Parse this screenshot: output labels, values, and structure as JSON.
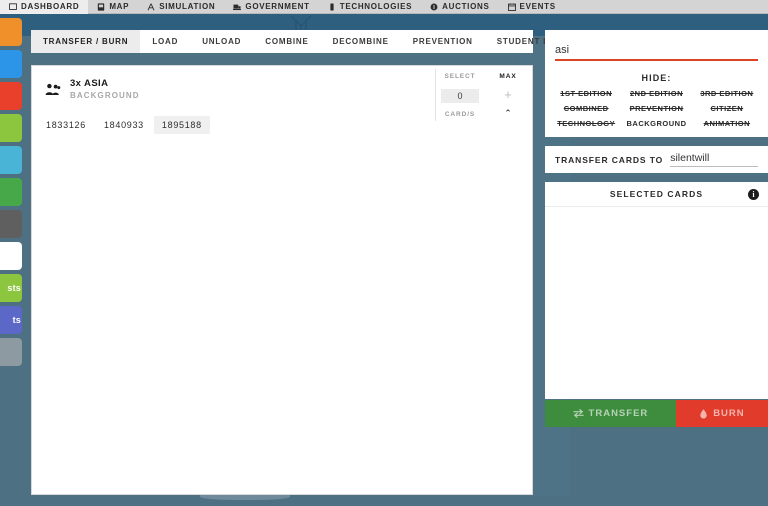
{
  "topnav": {
    "items": [
      {
        "label": "DASHBOARD",
        "icon": "monitor-icon",
        "active": true
      },
      {
        "label": "MAP",
        "icon": "map-icon",
        "active": false
      },
      {
        "label": "SIMULATION",
        "icon": "people-icon",
        "active": false
      },
      {
        "label": "GOVERNMENT",
        "icon": "building-icon",
        "active": false
      },
      {
        "label": "TECHNOLOGIES",
        "icon": "chip-icon",
        "active": false
      },
      {
        "label": "AUCTIONS",
        "icon": "gavel-icon",
        "active": false
      },
      {
        "label": "EVENTS",
        "icon": "calendar-icon",
        "active": false
      }
    ]
  },
  "rail": {
    "items": [
      {
        "label": "",
        "color": "#f0902a"
      },
      {
        "label": "",
        "color": "#2d95e8"
      },
      {
        "label": "",
        "color": "#e8402a"
      },
      {
        "label": "",
        "color": "#8cc63f"
      },
      {
        "label": "",
        "color": "#49b4d6"
      },
      {
        "label": "",
        "color": "#47a84a"
      },
      {
        "label": "",
        "color": "#5f5f5f"
      },
      {
        "label": "",
        "color": "#ffffff"
      },
      {
        "label": "sts",
        "color": "#8cc63f"
      },
      {
        "label": "ts",
        "color": "#5b68c8"
      },
      {
        "label": "",
        "color": "#8d9aa2"
      }
    ]
  },
  "subtabs": {
    "items": [
      {
        "label": "TRANSFER / BURN",
        "active": true
      },
      {
        "label": "LOAD",
        "active": false
      },
      {
        "label": "UNLOAD",
        "active": false
      },
      {
        "label": "COMBINE",
        "active": false
      },
      {
        "label": "DECOMBINE",
        "active": false
      },
      {
        "label": "PREVENTION",
        "active": false
      },
      {
        "label": "STUDENT DEBT",
        "active": false
      }
    ]
  },
  "card": {
    "icon": "group-people-icon",
    "title": "3x ASIA",
    "subtitle": "BACKGROUND",
    "ids": [
      {
        "value": "1833126",
        "highlighted": false
      },
      {
        "value": "1840933",
        "highlighted": false
      },
      {
        "value": "1895188",
        "highlighted": true
      }
    ],
    "stepper": {
      "select_label": "SELECT",
      "select_value": "0",
      "unit_label": "CARD/S",
      "max_label": "MAX",
      "plus_glyph": "+",
      "chevron_glyph": "⌃"
    }
  },
  "search": {
    "value": "asi",
    "placeholder": "",
    "underline_color": "#dd4422"
  },
  "hide": {
    "title": "HIDE:",
    "options": [
      {
        "label": "1ST EDITION",
        "struck": true
      },
      {
        "label": "2ND EDITION",
        "struck": true
      },
      {
        "label": "3RD EDITION",
        "struck": true
      },
      {
        "label": "COMBINED",
        "struck": true
      },
      {
        "label": "PREVENTION",
        "struck": true
      },
      {
        "label": "CITIZEN",
        "struck": true
      },
      {
        "label": "TECHNOLOGY",
        "struck": true
      },
      {
        "label": "BACKGROUND",
        "struck": false
      },
      {
        "label": "ANIMATION",
        "struck": true
      }
    ]
  },
  "transfer_to": {
    "label": "TRANSFER CARDS TO",
    "value": "silentwill",
    "placeholder": ""
  },
  "selected": {
    "title": "SELECTED CARDS",
    "info_glyph": "i",
    "items": []
  },
  "actions": {
    "transfer_label": "TRANSFER",
    "transfer_color": "#3e8c3e",
    "transfer_icon": "transfer-arrows-icon",
    "burn_label": "BURN",
    "burn_color": "#e03b2b",
    "burn_icon": "flame-icon"
  }
}
